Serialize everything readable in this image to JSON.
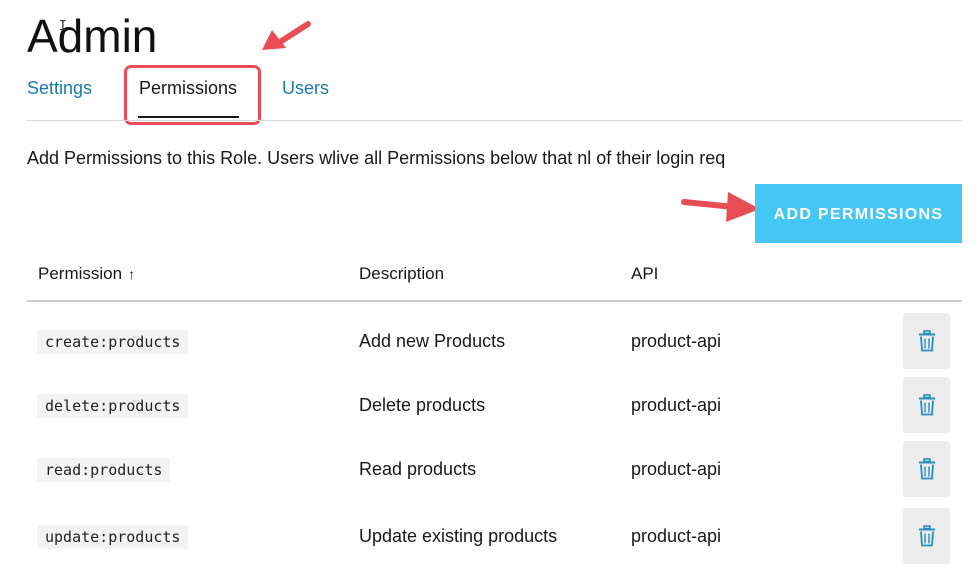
{
  "page": {
    "title": "Admin",
    "cursor_glyph": "I"
  },
  "tabs": [
    {
      "label": "Settings",
      "active": false
    },
    {
      "label": "Permissions",
      "active": true
    },
    {
      "label": "Users",
      "active": false
    }
  ],
  "description": "Add Permissions to this Role. Users wlive all Permissions below that nl of their login req",
  "add_button": {
    "label": "ADD PERMISSIONS"
  },
  "table": {
    "columns": [
      {
        "label": "Permission",
        "sort_icon": "↑"
      },
      {
        "label": "Description"
      },
      {
        "label": "API"
      }
    ],
    "rows": [
      {
        "permission": "create:products",
        "description": "Add new Products",
        "api": "product-api"
      },
      {
        "permission": "delete:products",
        "description": "Delete products",
        "api": "product-api"
      },
      {
        "permission": "read:products",
        "description": "Read products",
        "api": "product-api"
      },
      {
        "permission": "update:products",
        "description": "Update existing products",
        "api": "product-api"
      }
    ]
  },
  "colors": {
    "accent_button": "#44c7f4",
    "tab_link": "#1a7ba8",
    "annotation": "#e84d55",
    "trash_icon": "#2a8fc0"
  },
  "icons": {
    "row_action": "trash-icon",
    "sort": "arrow-up-icon"
  }
}
